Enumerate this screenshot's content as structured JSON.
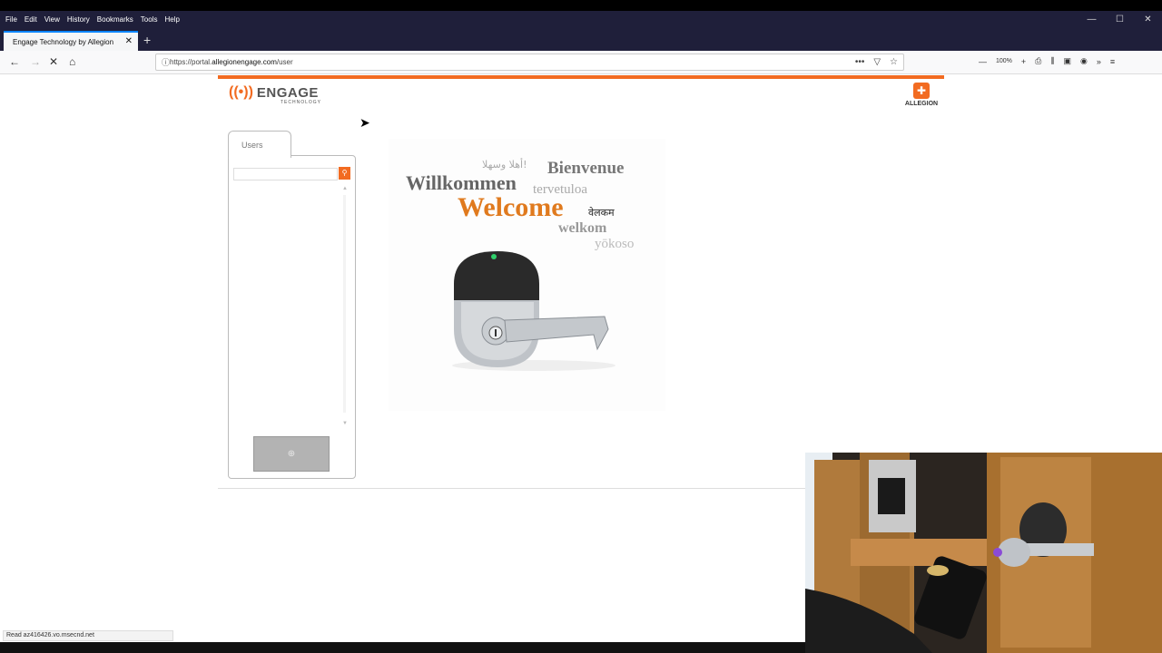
{
  "browser": {
    "menu": [
      "File",
      "Edit",
      "View",
      "History",
      "Bookmarks",
      "Tools",
      "Help"
    ],
    "tab_title": "Engage Technology by Allegion",
    "tab_close": "✕",
    "new_tab": "+",
    "url_prefix": "https://portal.",
    "url_host": "allegionengage.com",
    "url_path": "/user",
    "zoom": "100%",
    "status_text": "Read az416426.vo.msecnd.net",
    "window_controls": [
      "—",
      "☐",
      "✕"
    ]
  },
  "header": {
    "logo_word": "ENGAGE",
    "logo_sub": "TECHNOLOGY",
    "brand_right": "ALLEGION"
  },
  "users_panel": {
    "tab_label": "Users",
    "search_placeholder": "",
    "add_button_label": "⊕"
  },
  "welcome_words": {
    "arabic": "أهلا وسهلا!",
    "french": "Bienvenue",
    "german": "Willkommen",
    "finnish": "tervetuloa",
    "english": "Welcome",
    "hindi": "वेलकम",
    "dutch": "welkom",
    "japanese": "yōkoso"
  },
  "colors": {
    "accent": "#f26b21",
    "welcome": "#e07a1e"
  }
}
